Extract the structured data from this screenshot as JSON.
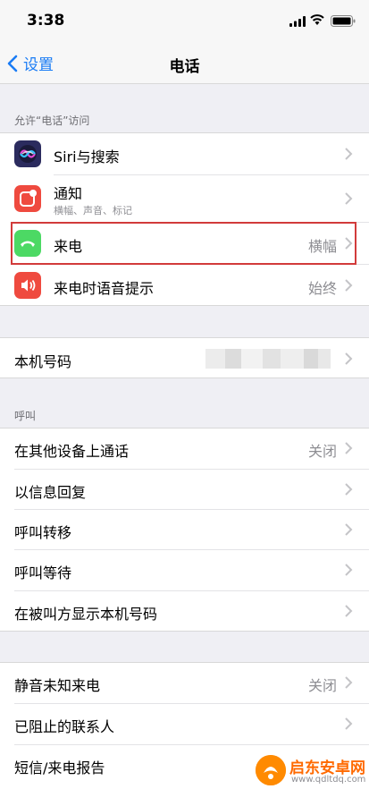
{
  "status_bar": {
    "time": "3:38"
  },
  "nav": {
    "back_label": "设置",
    "title": "电话"
  },
  "section1": {
    "header": "允许“电话”访问",
    "rows": [
      {
        "label": "Siri与搜索",
        "sub": "",
        "value": ""
      },
      {
        "label": "通知",
        "sub": "横幅、声音、标记",
        "value": ""
      },
      {
        "label": "来电",
        "sub": "",
        "value": "横幅"
      },
      {
        "label": "来电时语音提示",
        "sub": "",
        "value": "始终"
      }
    ]
  },
  "section2": {
    "rows": [
      {
        "label": "本机号码",
        "value": ""
      }
    ]
  },
  "section3": {
    "header": "呼叫",
    "rows": [
      {
        "label": "在其他设备上通话",
        "value": "关闭"
      },
      {
        "label": "以信息回复",
        "value": ""
      },
      {
        "label": "呼叫转移",
        "value": ""
      },
      {
        "label": "呼叫等待",
        "value": ""
      },
      {
        "label": "在被叫方显示本机号码",
        "value": ""
      }
    ]
  },
  "section4": {
    "rows": [
      {
        "label": "静音未知来电",
        "value": "关闭"
      },
      {
        "label": "已阻止的联系人",
        "value": ""
      },
      {
        "label": "短信/来电报告",
        "value": ""
      }
    ]
  },
  "watermark": {
    "name": "启东安卓网",
    "url": "www.qdltdq.com"
  },
  "colors": {
    "accent": "#1a7cf5",
    "siri_icon": "#2b2b5e",
    "notifications_icon": "#ef4a3f",
    "incoming_call_icon": "#4cd964",
    "announce_calls_icon": "#ef4a3f",
    "highlight_border": "#d23b3b"
  }
}
